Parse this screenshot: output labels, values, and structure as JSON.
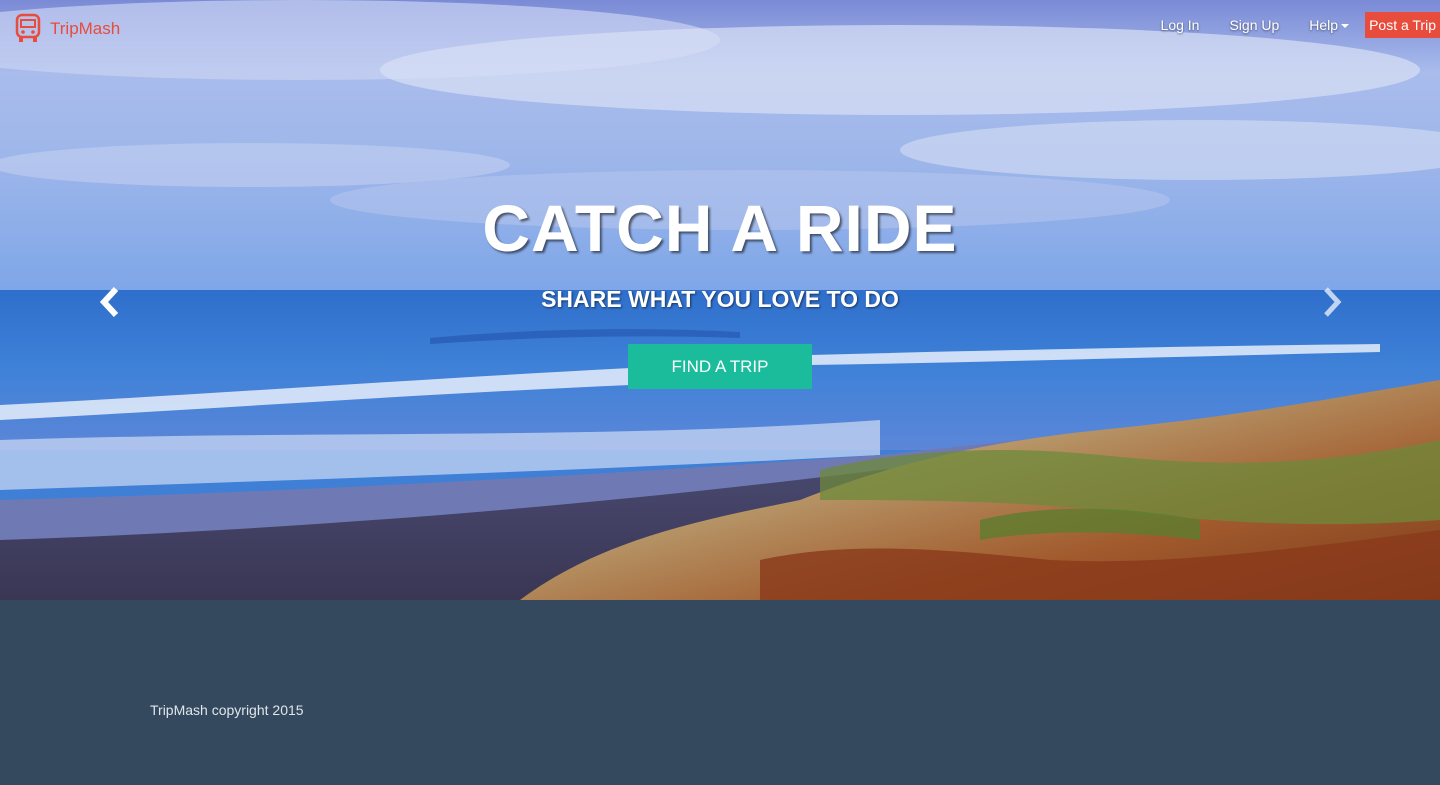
{
  "brand": {
    "name": "TripMash",
    "logo_icon": "bus-icon",
    "color": "#e74c3c"
  },
  "nav": {
    "login_label": "Log In",
    "signup_label": "Sign Up",
    "help_label": "Help",
    "post_label": "Post a Trip"
  },
  "hero": {
    "title": "CATCH A RIDE",
    "subtitle": "SHARE WHAT YOU LOVE TO DO",
    "cta_label": "FIND A TRIP",
    "cta_color": "#1abc9c",
    "prev_icon": "chevron-left-icon",
    "next_icon": "chevron-right-icon"
  },
  "footer": {
    "copyright": "TripMash copyright 2015",
    "background": "#34495e"
  }
}
